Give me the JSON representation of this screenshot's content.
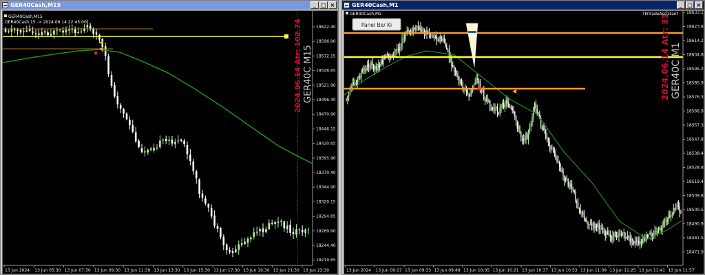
{
  "left": {
    "window_title": "GER40Cash,M15",
    "chart_symbol_label": "GER40Cash,M15",
    "indicator_text": "GER40Cash 15 -> 2024.06.14 22:45:00",
    "watermark_symbol": "GER40C M15",
    "watermark_datetime": "2024.06.14 Atr: 102.74",
    "price_labels": [
      "18622.40",
      "18596.90",
      "18572.15",
      "18546.65",
      "18521.90",
      "18496.40",
      "18470.90",
      "18446.15",
      "18420.65",
      "18395.90",
      "18370.40",
      "18344.90",
      "18320.15",
      "18294.65",
      "18269.90",
      "18244.40",
      "18219.65"
    ],
    "time_labels": [
      "13 Jun 2024",
      "13 Jun 05:30",
      "13 Jun 07:30",
      "13 Jun 09:30",
      "13 Jun 11:30",
      "13 Jun 13:30",
      "13 Jun 15:30",
      "13 Jun 17:30",
      "13 Jun 19:30",
      "13 Jun 21:30",
      "13 Jun 23:30"
    ]
  },
  "right": {
    "window_title": "GER40Cash,M1",
    "chart_symbol_label": "GER40Cash,M1",
    "assistant_label": "TNTradeAssistant",
    "panel_button": "Panel Be/ Ki",
    "watermark_symbol": "GER40C M1",
    "watermark_datetime": "2024.06.14 Atr: 31.43",
    "price_labels": [
      "18633.15",
      "18623.80",
      "18614.20",
      "18604.85",
      "18595.25",
      "18585.90",
      "18576.30",
      "18566.95",
      "18557.35",
      "18547.85",
      "18538.40",
      "18528.85",
      "18519.45",
      "18509.85",
      "18500.50",
      "18490.90",
      "18481.55",
      "18471.95"
    ],
    "time_labels": [
      "13 Jun 2024",
      "13 Jun 09:17",
      "13 Jun 09:33",
      "13 Jun 09:49",
      "13 Jun 10:05",
      "13 Jun 10:21",
      "13 Jun 10:37",
      "13 Jun 10:53",
      "13 Jun 11:09",
      "13 Jun 11:25",
      "13 Jun 11:41",
      "13 Jun 11:57"
    ]
  },
  "colors": {
    "title_active": "#0a246a",
    "title_inactive": "#7a96df",
    "bull": "#b9f5a0",
    "bear": "#ffffff",
    "ma": "#1e8c1e",
    "yellow_line": "#ffff33",
    "orange_line": "#ff9a2a",
    "watermark_red": "#c8102e",
    "watermark_gray": "#c8c8c8"
  },
  "icons": [
    "minimize-icon",
    "maximize-icon",
    "close-icon",
    "app-icon"
  ]
}
